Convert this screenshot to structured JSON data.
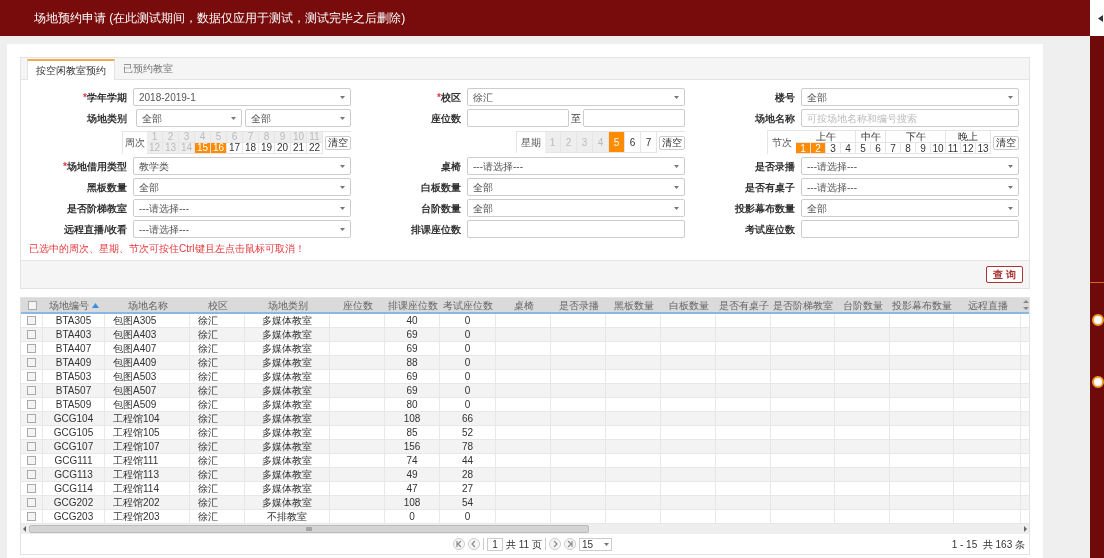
{
  "header": {
    "title": "场地预约申请 (在此测试期间，数据仅应用于测试，测试完毕之后删除)"
  },
  "tabs": [
    {
      "label": "按空闲教室预约",
      "selected": true
    },
    {
      "label": "已预约教室",
      "selected": false
    }
  ],
  "form": {
    "rows": [
      [
        {
          "kind": "select",
          "marker": "*",
          "label": "学年学期",
          "value": "2018-2019-1"
        },
        {
          "kind": "select",
          "marker": "*",
          "label": "校区",
          "value": "徐汇"
        },
        {
          "kind": "select",
          "label": "楼号",
          "value": "全部"
        }
      ],
      [
        {
          "kind": "select_pair",
          "label": "场地类别",
          "values": [
            "全部",
            "全部"
          ]
        },
        {
          "kind": "range",
          "label": "座位数",
          "separator": "至"
        },
        {
          "kind": "input",
          "label": "场地名称",
          "placeholder": "可按场地名称和编号搜索"
        }
      ],
      [
        {
          "kind": "week_grid",
          "label": "周次",
          "clear": "清空",
          "cells": [
            {
              "label": "1",
              "disabled": true,
              "selected": false
            },
            {
              "label": "2",
              "disabled": true,
              "selected": false
            },
            {
              "label": "3",
              "disabled": true,
              "selected": false
            },
            {
              "label": "4",
              "disabled": true,
              "selected": false
            },
            {
              "label": "5",
              "disabled": true,
              "selected": false
            },
            {
              "label": "6",
              "disabled": true,
              "selected": false
            },
            {
              "label": "7",
              "disabled": true,
              "selected": false
            },
            {
              "label": "8",
              "disabled": true,
              "selected": false
            },
            {
              "label": "9",
              "disabled": true,
              "selected": false
            },
            {
              "label": "10",
              "disabled": true,
              "selected": false
            },
            {
              "label": "11",
              "disabled": true,
              "selected": false
            },
            {
              "label": "12",
              "disabled": true,
              "selected": false
            },
            {
              "label": "13",
              "disabled": true,
              "selected": false
            },
            {
              "label": "14",
              "disabled": true,
              "selected": false
            },
            {
              "label": "15",
              "disabled": false,
              "selected": true
            },
            {
              "label": "16",
              "disabled": false,
              "selected": true
            },
            {
              "label": "17",
              "disabled": false,
              "selected": false
            },
            {
              "label": "18",
              "disabled": false,
              "selected": false
            },
            {
              "label": "19",
              "disabled": false,
              "selected": false
            },
            {
              "label": "20",
              "disabled": false,
              "selected": false
            },
            {
              "label": "21",
              "disabled": false,
              "selected": false
            },
            {
              "label": "22",
              "disabled": false,
              "selected": false
            }
          ]
        },
        {
          "kind": "day_grid",
          "label": "星期",
          "clear": "清空",
          "cells": [
            {
              "label": "1",
              "disabled": true,
              "selected": false
            },
            {
              "label": "2",
              "disabled": true,
              "selected": false
            },
            {
              "label": "3",
              "disabled": true,
              "selected": false
            },
            {
              "label": "4",
              "disabled": true,
              "selected": false
            },
            {
              "label": "5",
              "disabled": false,
              "selected": true
            },
            {
              "label": "6",
              "disabled": false,
              "selected": false
            },
            {
              "label": "7",
              "disabled": false,
              "selected": false
            }
          ]
        },
        {
          "kind": "period_grid",
          "label": "节次",
          "clear": "清空",
          "groups": [
            {
              "label": "上午",
              "cells": [
                {
                  "label": "1",
                  "selected": true
                },
                {
                  "label": "2",
                  "selected": true
                },
                {
                  "label": "3",
                  "selected": false
                },
                {
                  "label": "4",
                  "selected": false
                }
              ]
            },
            {
              "label": "中午",
              "cells": [
                {
                  "label": "5",
                  "selected": false
                },
                {
                  "label": "6",
                  "selected": false
                }
              ]
            },
            {
              "label": "下午",
              "cells": [
                {
                  "label": "7",
                  "selected": false
                },
                {
                  "label": "8",
                  "selected": false
                },
                {
                  "label": "9",
                  "selected": false
                },
                {
                  "label": "10",
                  "selected": false
                }
              ]
            },
            {
              "label": "晚上",
              "cells": [
                {
                  "label": "11",
                  "selected": false
                },
                {
                  "label": "12",
                  "selected": false
                },
                {
                  "label": "13",
                  "selected": false
                }
              ]
            }
          ]
        }
      ],
      [
        {
          "kind": "select",
          "marker": "*",
          "label": "场地借用类型",
          "value": "教学类"
        },
        {
          "kind": "select",
          "label": "桌椅",
          "value": "---请选择---"
        },
        {
          "kind": "select",
          "label": "是否录播",
          "value": "---请选择---"
        }
      ],
      [
        {
          "kind": "select",
          "label": "黑板数量",
          "value": "全部"
        },
        {
          "kind": "select",
          "label": "白板数量",
          "value": "全部"
        },
        {
          "kind": "select",
          "label": "是否有桌子",
          "value": "---请选择---"
        }
      ],
      [
        {
          "kind": "select",
          "label": "是否阶梯教室",
          "value": "---请选择---"
        },
        {
          "kind": "select",
          "label": "台阶数量",
          "value": "全部"
        },
        {
          "kind": "select",
          "label": "投影幕布数量",
          "value": "全部"
        }
      ],
      [
        {
          "kind": "select",
          "label": "远程直播/收看",
          "value": "---请选择---"
        },
        {
          "kind": "input",
          "label": "排课座位数"
        },
        {
          "kind": "input",
          "label": "考试座位数"
        }
      ]
    ]
  },
  "note": "已选中的周次、星期、节次可按住Ctrl键且左点击鼠标可取消！",
  "query_button": "查 询",
  "table": {
    "select_all": {
      "checked": false
    },
    "columns": [
      {
        "label": "场地编号",
        "sorted": true
      },
      {
        "label": "场地名称"
      },
      {
        "label": "校区"
      },
      {
        "label": "场地类别"
      },
      {
        "label": "座位数"
      },
      {
        "label": "排课座位数"
      },
      {
        "label": "考试座位数"
      },
      {
        "label": "桌椅"
      },
      {
        "label": "是否录播"
      },
      {
        "label": "黑板数量"
      },
      {
        "label": "白板数量"
      },
      {
        "label": "是否有桌子"
      },
      {
        "label": "是否阶梯教室"
      },
      {
        "label": "台阶数量"
      },
      {
        "label": "投影幕布数量"
      },
      {
        "label": "远程直播"
      }
    ],
    "rows": [
      {
        "checked": false,
        "cells": [
          "BTA305",
          "包图A305",
          "徐汇",
          "多媒体教室",
          null,
          "40",
          "0"
        ]
      },
      {
        "checked": false,
        "cells": [
          "BTA403",
          "包图A403",
          "徐汇",
          "多媒体教室",
          null,
          "69",
          "0"
        ]
      },
      {
        "checked": false,
        "cells": [
          "BTA407",
          "包图A407",
          "徐汇",
          "多媒体教室",
          null,
          "69",
          "0"
        ]
      },
      {
        "checked": false,
        "cells": [
          "BTA409",
          "包图A409",
          "徐汇",
          "多媒体教室",
          null,
          "88",
          "0"
        ]
      },
      {
        "checked": false,
        "cells": [
          "BTA503",
          "包图A503",
          "徐汇",
          "多媒体教室",
          null,
          "69",
          "0"
        ]
      },
      {
        "checked": false,
        "cells": [
          "BTA507",
          "包图A507",
          "徐汇",
          "多媒体教室",
          null,
          "69",
          "0"
        ]
      },
      {
        "checked": false,
        "cells": [
          "BTA509",
          "包图A509",
          "徐汇",
          "多媒体教室",
          null,
          "80",
          "0"
        ]
      },
      {
        "checked": false,
        "cells": [
          "GCG104",
          "工程馆104",
          "徐汇",
          "多媒体教室",
          null,
          "108",
          "66"
        ]
      },
      {
        "checked": false,
        "cells": [
          "GCG105",
          "工程馆105",
          "徐汇",
          "多媒体教室",
          null,
          "85",
          "52"
        ]
      },
      {
        "checked": false,
        "cells": [
          "GCG107",
          "工程馆107",
          "徐汇",
          "多媒体教室",
          null,
          "156",
          "78"
        ]
      },
      {
        "checked": false,
        "cells": [
          "GCG111",
          "工程馆111",
          "徐汇",
          "多媒体教室",
          null,
          "74",
          "44"
        ]
      },
      {
        "checked": false,
        "cells": [
          "GCG113",
          "工程馆113",
          "徐汇",
          "多媒体教室",
          null,
          "49",
          "28"
        ]
      },
      {
        "checked": false,
        "cells": [
          "GCG114",
          "工程馆114",
          "徐汇",
          "多媒体教室",
          null,
          "47",
          "27"
        ]
      },
      {
        "checked": false,
        "cells": [
          "GCG202",
          "工程馆202",
          "徐汇",
          "多媒体教室",
          null,
          "108",
          "54"
        ]
      },
      {
        "checked": false,
        "cells": [
          "GCG203",
          "工程馆203",
          "徐汇",
          "不排教室",
          null,
          "0",
          "0"
        ]
      }
    ]
  },
  "pagination": {
    "page": "1",
    "total_pages": "共 11 页",
    "page_size": "15",
    "summary": "1 - 15  共 163 条"
  }
}
